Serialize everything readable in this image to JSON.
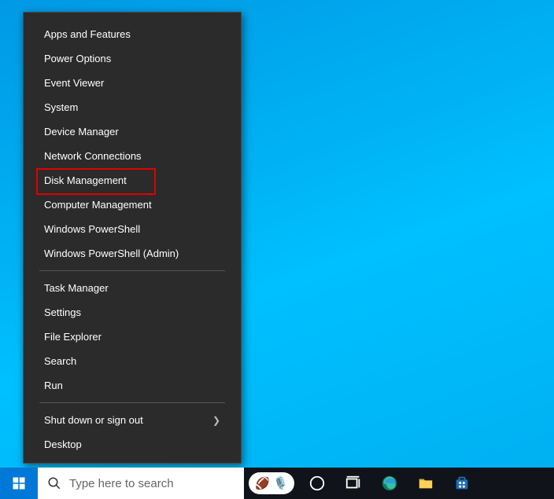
{
  "menu": {
    "group1": [
      "Apps and Features",
      "Power Options",
      "Event Viewer",
      "System",
      "Device Manager",
      "Network Connections",
      "Disk Management",
      "Computer Management",
      "Windows PowerShell",
      "Windows PowerShell (Admin)"
    ],
    "group2": [
      "Task Manager",
      "Settings",
      "File Explorer",
      "Search",
      "Run"
    ],
    "group3_submenu": "Shut down or sign out",
    "group3_last": "Desktop",
    "highlighted_index": 6
  },
  "search": {
    "placeholder": "Type here to search"
  },
  "tray": {
    "pill_items": [
      "🏈",
      "🎙️"
    ]
  }
}
